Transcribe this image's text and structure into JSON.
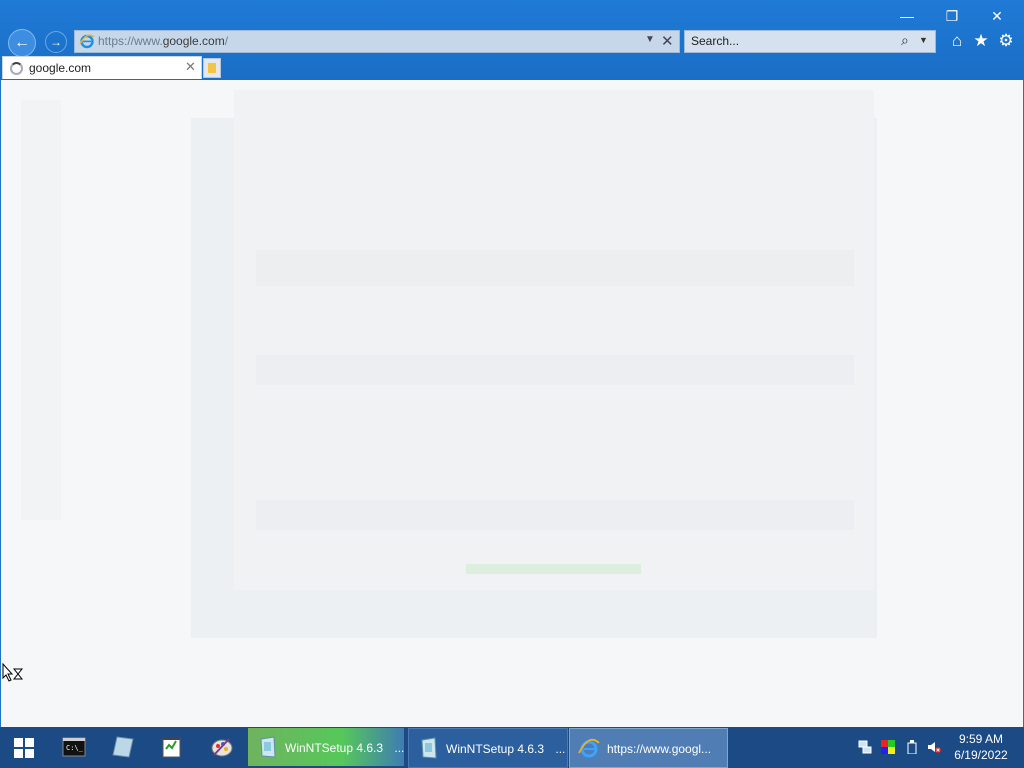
{
  "window": {
    "minimize_glyph": "—",
    "restore_glyph": "❐",
    "close_glyph": "✕"
  },
  "nav": {
    "back_glyph": "←",
    "forward_glyph": "→"
  },
  "address": {
    "url_prefix": "https://www.",
    "url_domain": "google.com",
    "url_suffix": "/",
    "dropdown_glyph": "▼",
    "refresh_stop_glyph": "✕"
  },
  "search": {
    "placeholder": "Search...",
    "icon_glyph": "⌕",
    "dropdown_glyph": "▼"
  },
  "toolbar": {
    "home_glyph": "⌂",
    "favorites_glyph": "★",
    "settings_glyph": "⚙"
  },
  "tabs": [
    {
      "label": "google.com",
      "close_glyph": "✕",
      "loading": true
    }
  ],
  "taskbar": {
    "tasks": [
      {
        "label": "WinNTSetup 4.6.3",
        "ellipsis": "..."
      },
      {
        "label": "WinNTSetup 4.6.3",
        "ellipsis": "..."
      },
      {
        "label": "https://www.googl..."
      }
    ],
    "clock": {
      "time": "9:59 AM",
      "date": "6/19/2022"
    }
  },
  "colors": {
    "accent": "#1a6ec5",
    "taskbar": "#1b4a84",
    "content_bg": "#f5f7f9"
  },
  "icons": [
    "back-icon",
    "forward-icon",
    "ie-icon",
    "search-icon",
    "home-icon",
    "favorites-icon",
    "settings-icon",
    "start-icon",
    "cmd-icon",
    "notepad-icon",
    "network-icon",
    "volume-muted-icon"
  ]
}
